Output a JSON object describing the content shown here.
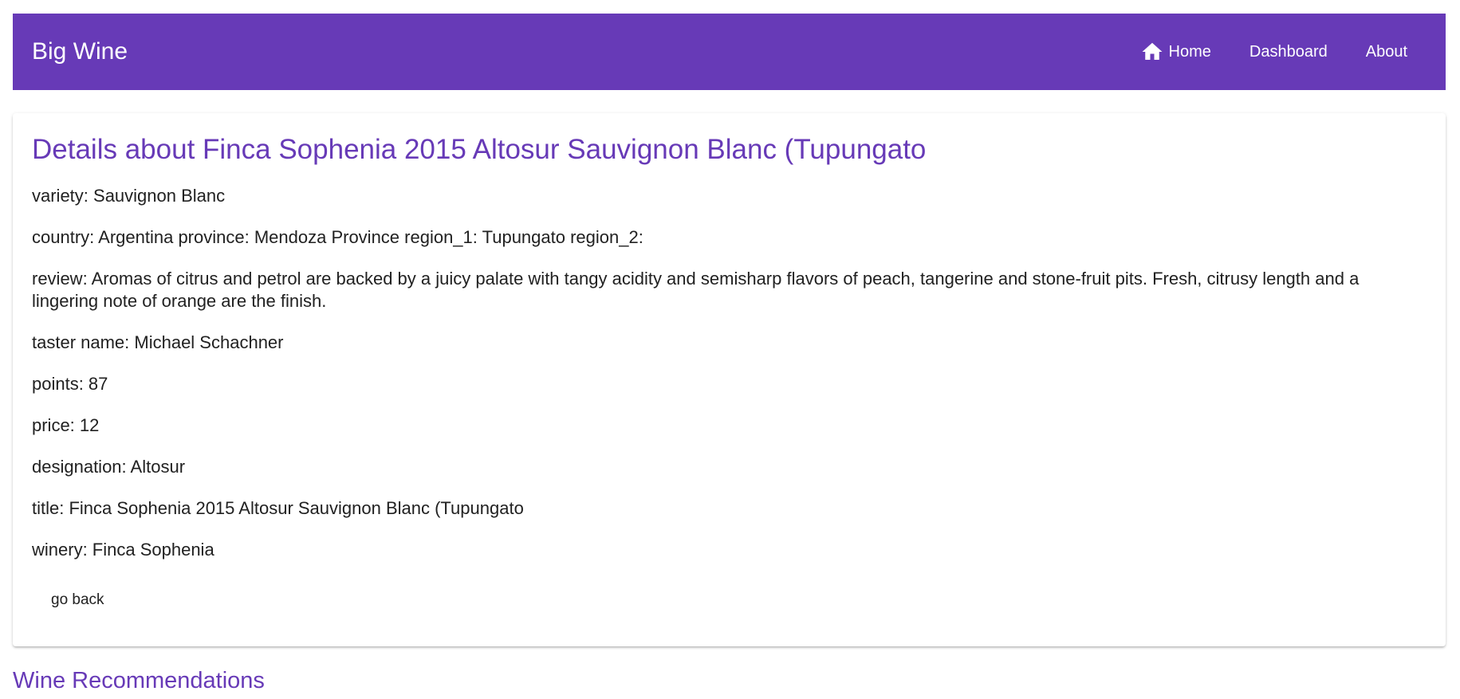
{
  "toolbar": {
    "brand": "Big Wine",
    "nav": [
      {
        "label": "Home",
        "icon": "home-icon"
      },
      {
        "label": "Dashboard"
      },
      {
        "label": "About"
      }
    ],
    "color": "#673ab7"
  },
  "details": {
    "heading": "Details about Finca Sophenia 2015 Altosur Sauvignon Blanc (Tupungato",
    "variety": "variety: Sauvignon Blanc",
    "location": "country: Argentina province: Mendoza Province region_1: Tupungato region_2:",
    "review": "review: Aromas of citrus and petrol are backed by a juicy palate with tangy acidity and semisharp flavors of peach, tangerine and stone-fruit pits. Fresh, citrusy length and a lingering note of orange are the finish.",
    "taster": "taster name: Michael Schachner",
    "points": "points: 87",
    "price": "price: 12",
    "designation": "designation: Altosur",
    "title": "title: Finca Sophenia 2015 Altosur Sauvignon Blanc (Tupungato",
    "winery": "winery: Finca Sophenia",
    "go_back_label": "go back"
  },
  "recommendations": {
    "heading": "Wine Recommendations"
  }
}
